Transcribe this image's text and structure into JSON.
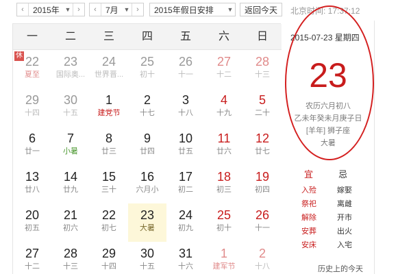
{
  "toolbar": {
    "year": "2015年",
    "month": "7月",
    "holiday": "2015年假日安排",
    "today_button": "返回今天",
    "clock": "北京时间: 17:37:12"
  },
  "weekdays": [
    "一",
    "二",
    "三",
    "四",
    "五",
    "六",
    "日"
  ],
  "days": [
    {
      "num": "22",
      "sub": "夏至",
      "other": true,
      "red": false,
      "subcolor": "red",
      "badge": "休"
    },
    {
      "num": "23",
      "sub": "国际奥...",
      "other": true,
      "red": false
    },
    {
      "num": "24",
      "sub": "世界晋...",
      "other": true,
      "red": false
    },
    {
      "num": "25",
      "sub": "初十",
      "other": true,
      "red": false
    },
    {
      "num": "26",
      "sub": "十一",
      "other": true,
      "red": false
    },
    {
      "num": "27",
      "sub": "十二",
      "other": true,
      "red": true
    },
    {
      "num": "28",
      "sub": "十三",
      "other": true,
      "red": true
    },
    {
      "num": "29",
      "sub": "十四",
      "other": true,
      "red": false
    },
    {
      "num": "30",
      "sub": "十五",
      "other": true,
      "red": false
    },
    {
      "num": "1",
      "sub": "建党节",
      "other": false,
      "red": false,
      "subcolor": "red"
    },
    {
      "num": "2",
      "sub": "十七",
      "other": false,
      "red": false
    },
    {
      "num": "3",
      "sub": "十八",
      "other": false,
      "red": false
    },
    {
      "num": "4",
      "sub": "十九",
      "other": false,
      "red": true
    },
    {
      "num": "5",
      "sub": "二十",
      "other": false,
      "red": true
    },
    {
      "num": "6",
      "sub": "廿一",
      "other": false,
      "red": false
    },
    {
      "num": "7",
      "sub": "小暑",
      "other": false,
      "red": false,
      "subcolor": "green"
    },
    {
      "num": "8",
      "sub": "廿三",
      "other": false,
      "red": false
    },
    {
      "num": "9",
      "sub": "廿四",
      "other": false,
      "red": false
    },
    {
      "num": "10",
      "sub": "廿五",
      "other": false,
      "red": false
    },
    {
      "num": "11",
      "sub": "廿六",
      "other": false,
      "red": true
    },
    {
      "num": "12",
      "sub": "廿七",
      "other": false,
      "red": true
    },
    {
      "num": "13",
      "sub": "廿八",
      "other": false,
      "red": false
    },
    {
      "num": "14",
      "sub": "廿九",
      "other": false,
      "red": false
    },
    {
      "num": "15",
      "sub": "三十",
      "other": false,
      "red": false
    },
    {
      "num": "16",
      "sub": "六月小",
      "other": false,
      "red": false
    },
    {
      "num": "17",
      "sub": "初二",
      "other": false,
      "red": false
    },
    {
      "num": "18",
      "sub": "初三",
      "other": false,
      "red": true
    },
    {
      "num": "19",
      "sub": "初四",
      "other": false,
      "red": true
    },
    {
      "num": "20",
      "sub": "初五",
      "other": false,
      "red": false
    },
    {
      "num": "21",
      "sub": "初六",
      "other": false,
      "red": false
    },
    {
      "num": "22",
      "sub": "初七",
      "other": false,
      "red": false
    },
    {
      "num": "23",
      "sub": "大暑",
      "other": false,
      "red": false,
      "today": true
    },
    {
      "num": "24",
      "sub": "初九",
      "other": false,
      "red": false
    },
    {
      "num": "25",
      "sub": "初十",
      "other": false,
      "red": true
    },
    {
      "num": "26",
      "sub": "十一",
      "other": false,
      "red": true
    },
    {
      "num": "27",
      "sub": "十二",
      "other": false,
      "red": false
    },
    {
      "num": "28",
      "sub": "十三",
      "other": false,
      "red": false
    },
    {
      "num": "29",
      "sub": "十四",
      "other": false,
      "red": false
    },
    {
      "num": "30",
      "sub": "十五",
      "other": false,
      "red": false
    },
    {
      "num": "31",
      "sub": "十六",
      "other": false,
      "red": false
    },
    {
      "num": "1",
      "sub": "建军节",
      "other": true,
      "red": true,
      "subcolor": "red"
    },
    {
      "num": "2",
      "sub": "十八",
      "other": true,
      "red": true
    }
  ],
  "detail": {
    "date": "2015-07-23  星期四",
    "big_day": "23",
    "lunar": "农历六月初八",
    "ganzhi": "乙未年癸未月庚子日",
    "zodiac": "[羊年] 狮子座",
    "term": "大暑"
  },
  "yiji": {
    "yi_label": "宜",
    "ji_label": "忌",
    "yi": [
      "入殓",
      "祭祀",
      "解除",
      "安葬",
      "安床"
    ],
    "ji": [
      "嫁娶",
      "离雌",
      "开市",
      "出火",
      "入宅"
    ]
  },
  "history_link": "历史上的今天",
  "colors": {
    "accent_red": "#c81c1c",
    "today_bg": "#fdf7d9"
  }
}
